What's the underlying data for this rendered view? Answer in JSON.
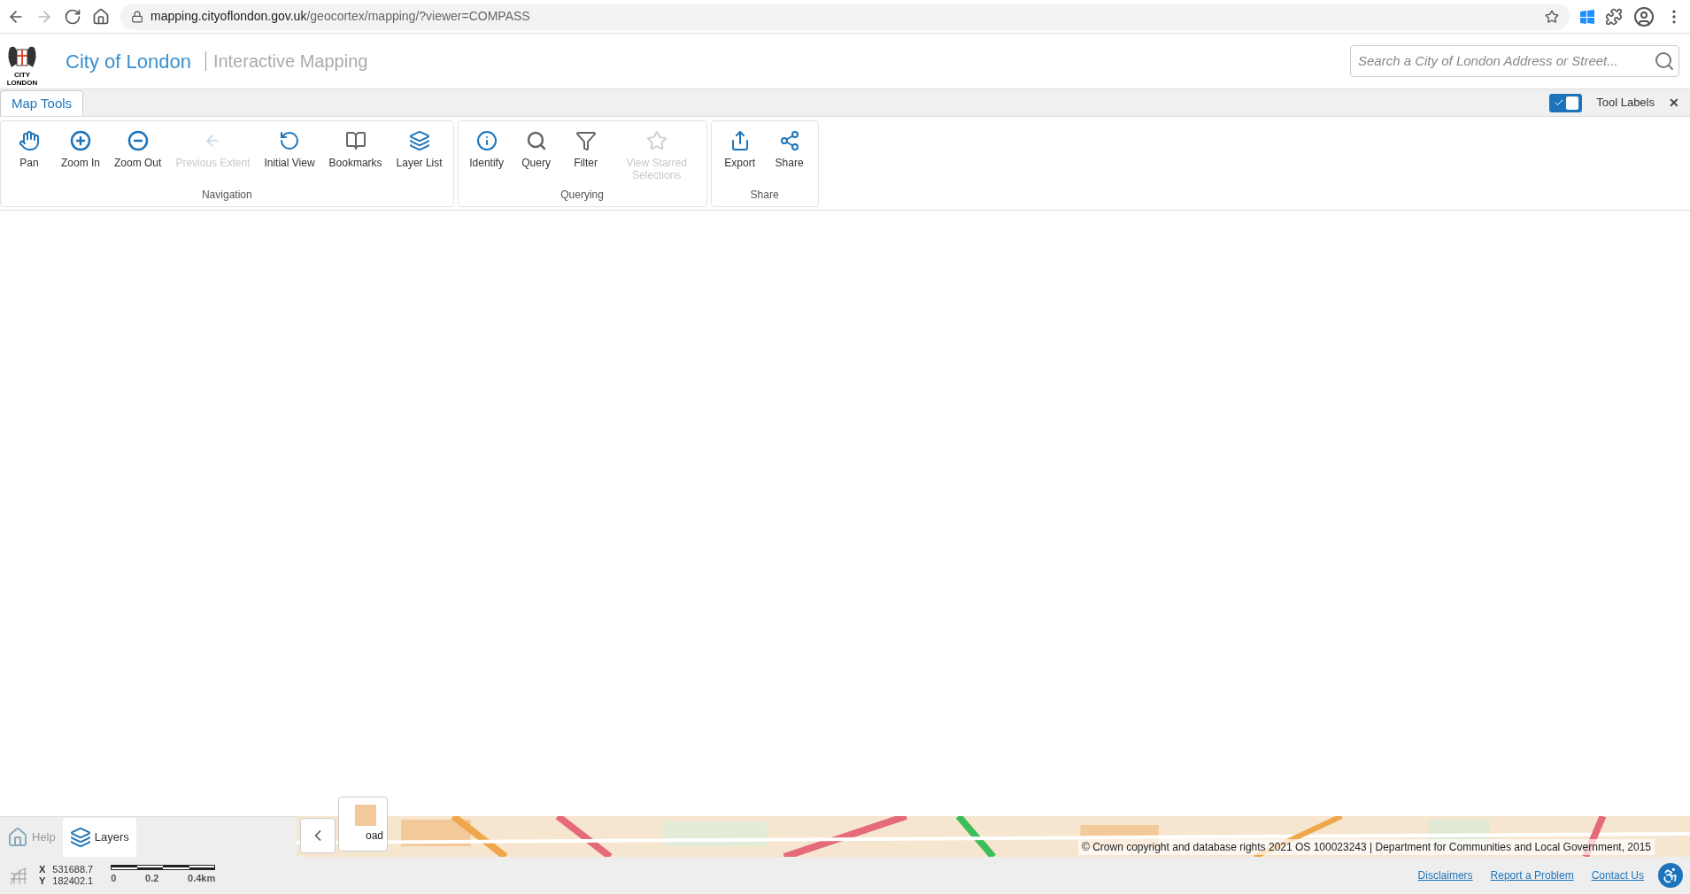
{
  "browser": {
    "url_host": "mapping.cityoflondon.gov.uk",
    "url_path": "/geocortex/mapping/?viewer=COMPASS"
  },
  "header": {
    "logo_line1": "CITY",
    "logo_line2": "LONDON",
    "title": "City of London",
    "subtitle": "Interactive Mapping",
    "search": {
      "placeholder": "Search a City of London Address or Street..."
    }
  },
  "tabs": [
    {
      "label": "Map Tools",
      "selected": true
    }
  ],
  "tool_labels": {
    "label": "Tool Labels",
    "checked": true,
    "close": "✕"
  },
  "tool_groups": [
    {
      "name": "Navigation",
      "tools": [
        {
          "kind": "pan",
          "label": "Pan",
          "disabled": false
        },
        {
          "kind": "zoom-in",
          "label": "Zoom In",
          "disabled": false
        },
        {
          "kind": "zoom-out",
          "label": "Zoom Out",
          "disabled": false
        },
        {
          "kind": "previous",
          "label": "Previous Extent",
          "disabled": true
        },
        {
          "kind": "initial",
          "label": "Initial View",
          "disabled": false
        },
        {
          "kind": "bookmarks",
          "label": "Bookmarks",
          "disabled": false
        },
        {
          "kind": "layers",
          "label": "Layer List",
          "disabled": false
        }
      ]
    },
    {
      "name": "Querying",
      "tools": [
        {
          "kind": "identify",
          "label": "Identify",
          "disabled": false
        },
        {
          "kind": "query",
          "label": "Query",
          "disabled": false
        },
        {
          "kind": "filter",
          "label": "Filter",
          "disabled": false
        },
        {
          "kind": "starred",
          "label": "View Starred Selections",
          "disabled": true
        }
      ]
    },
    {
      "name": "Share",
      "tools": [
        {
          "kind": "export",
          "label": "Export",
          "disabled": false
        },
        {
          "kind": "share",
          "label": "Share",
          "disabled": false
        }
      ]
    }
  ],
  "panel_tabs": [
    {
      "kind": "help",
      "label": "Help",
      "selected": false
    },
    {
      "kind": "layers",
      "label": "Layers",
      "selected": true
    }
  ],
  "basemap": {
    "label": "oad"
  },
  "attribution": "© Crown copyright and database rights 2021 OS 100023243 | Department for Communities and Local Government, 2015",
  "status_bar": {
    "x_label": "X",
    "x_value": "531688.7",
    "y_label": "Y",
    "y_value": "182402.1",
    "scale_labels": [
      "0",
      "0.2",
      "0.4km"
    ],
    "links": [
      "Disclaimers",
      "Report a Problem",
      "Contact Us"
    ]
  }
}
